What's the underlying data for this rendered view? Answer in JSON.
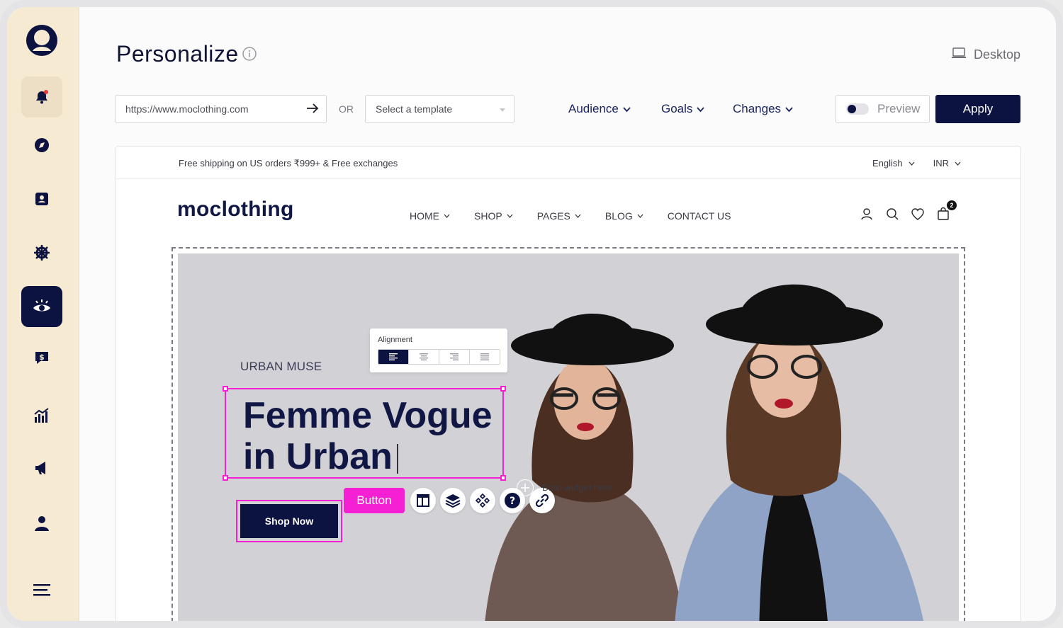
{
  "app": {
    "title": "Personalize",
    "view_mode": "Desktop"
  },
  "toolbar": {
    "url_value": "https://www.moclothing.com",
    "or_label": "OR",
    "template_placeholder": "Select a template",
    "audience_label": "Audience",
    "goals_label": "Goals",
    "changes_label": "Changes",
    "preview_label": "Preview",
    "apply_label": "Apply"
  },
  "sidebar": {
    "items": [
      {
        "icon": "bell-icon"
      },
      {
        "icon": "compass-icon"
      },
      {
        "icon": "contact-card-icon"
      },
      {
        "icon": "ship-wheel-icon"
      },
      {
        "icon": "eye-icon"
      },
      {
        "icon": "dollar-chat-icon"
      },
      {
        "icon": "bar-chart-icon"
      },
      {
        "icon": "megaphone-icon"
      },
      {
        "icon": "user-icon"
      },
      {
        "icon": "menu-icon"
      }
    ]
  },
  "site": {
    "announcement": "Free shipping on US orders  ₹999+ & Free exchanges",
    "language": "English",
    "currency": "INR",
    "brand": "moclothing",
    "nav": [
      "HOME",
      "SHOP",
      "PAGES",
      "BLOG",
      "CONTACT US"
    ],
    "cart_count": "2",
    "hero": {
      "eyebrow": "URBAN MUSE",
      "headline_line1": "Femme Vogue",
      "headline_line2": "in Urban",
      "cta": "Shop Now"
    }
  },
  "editor": {
    "alignment_label": "Alignment",
    "element_tag": "Button",
    "drop_hint": "Drop widget here"
  },
  "colors": {
    "navy": "#0c1340",
    "highlight": "#f51fd4",
    "sidebar": "#f6ead2"
  }
}
